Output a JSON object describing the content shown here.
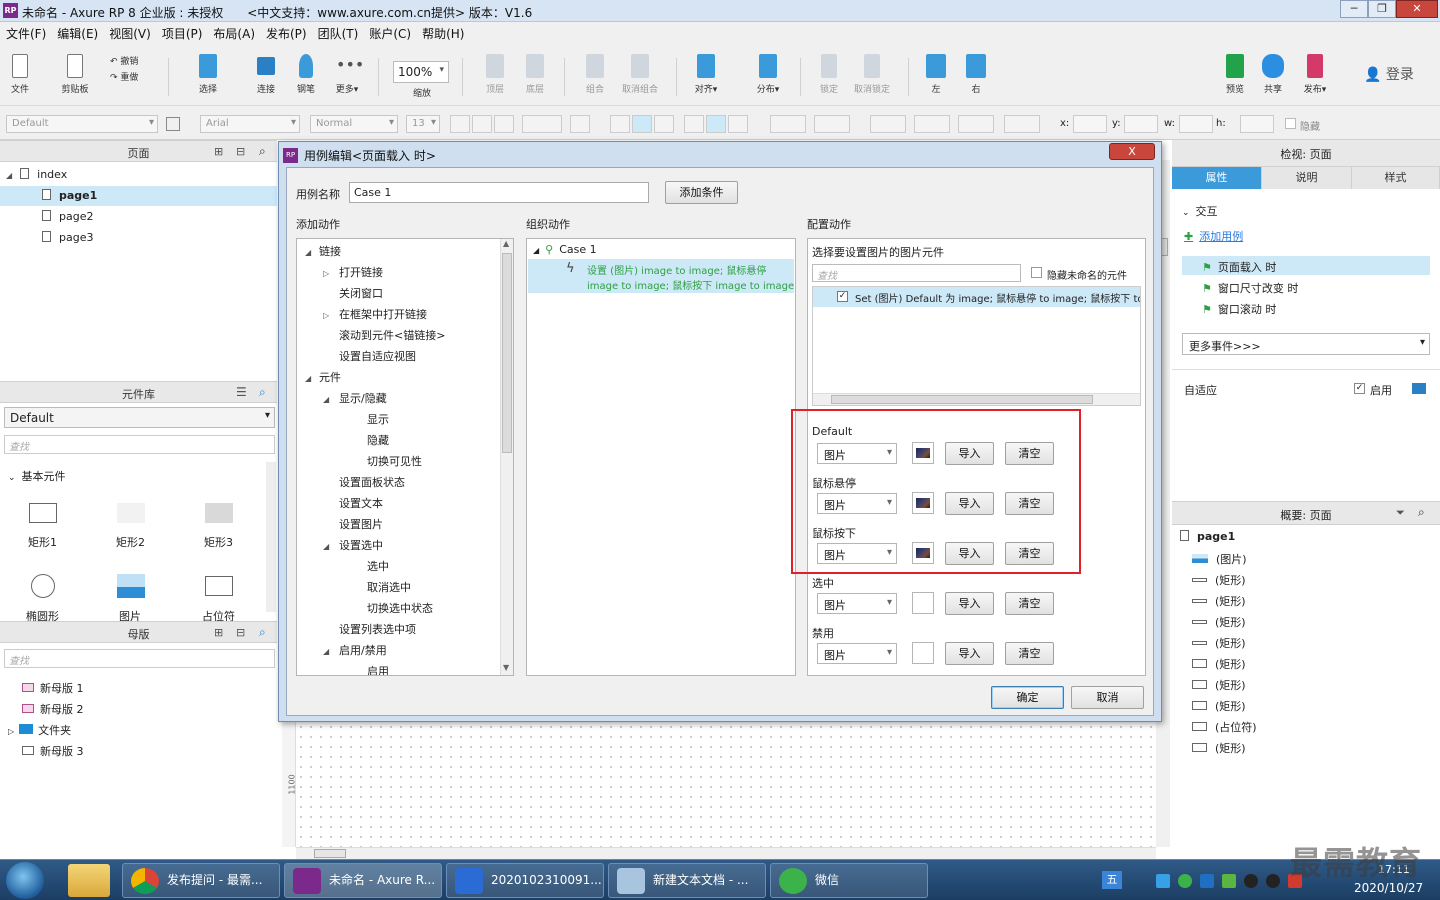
{
  "window": {
    "title": "未命名 - Axure RP 8 企业版 : 未授权　　<中文支持：www.axure.com.cn提供> 版本：V1.6",
    "logo": "RP"
  },
  "menu": [
    "文件(F)",
    "编辑(E)",
    "视图(V)",
    "项目(P)",
    "布局(A)",
    "发布(P)",
    "团队(T)",
    "账户(C)",
    "帮助(H)"
  ],
  "toolbar": {
    "file": "文件",
    "clipboard": "剪贴板",
    "undo": "撤销",
    "redo": "重做",
    "select": "选择",
    "connect": "连接",
    "pen": "钢笔",
    "more": "更多▾",
    "zoom": "100%",
    "zoom_label": "缩放",
    "top": "顶层",
    "bottom": "底层",
    "group": "组合",
    "ungroup": "取消组合",
    "align": "对齐▾",
    "distribute": "分布▾",
    "lock": "锁定",
    "unlock": "取消锁定",
    "left": "左",
    "right": "右",
    "preview": "预览",
    "share": "共享",
    "publish": "发布▾",
    "login": "登录"
  },
  "format": {
    "style": "Default",
    "font": "Arial",
    "weight": "Normal",
    "size": "13",
    "x": "x:",
    "y": "y:",
    "w": "w:",
    "h": "h:",
    "hidden": "隐藏"
  },
  "pages_panel": {
    "title": "页面",
    "items": [
      "index",
      "page1",
      "page2",
      "page3"
    ]
  },
  "library_panel": {
    "title": "元件库",
    "select": "Default",
    "search_placeholder": "查找",
    "group": "基本元件",
    "widgets": [
      "矩形1",
      "矩形2",
      "矩形3",
      "椭圆形",
      "图片",
      "占位符"
    ]
  },
  "masters_panel": {
    "title": "母版",
    "search_placeholder": "查找",
    "items": [
      "新母版 1",
      "新母版 2",
      "文件夹",
      "新母版 3"
    ]
  },
  "dialog": {
    "title": "用例编辑<页面载入 时>",
    "close": "X",
    "case_name_label": "用例名称",
    "case_name_value": "Case 1",
    "add_condition": "添加条件",
    "add_actions_title": "添加动作",
    "organize_title": "组织动作",
    "config_title": "配置动作",
    "actions_tree": [
      {
        "t": "链接",
        "lv": 0,
        "exp": "◢"
      },
      {
        "t": "打开链接",
        "lv": 1,
        "exp": "▷"
      },
      {
        "t": "关闭窗口",
        "lv": 1,
        "exp": ""
      },
      {
        "t": "在框架中打开链接",
        "lv": 1,
        "exp": "▷"
      },
      {
        "t": "滚动到元件<锚链接>",
        "lv": 1,
        "exp": ""
      },
      {
        "t": "设置自适应视图",
        "lv": 1,
        "exp": ""
      },
      {
        "t": "元件",
        "lv": 0,
        "exp": "◢"
      },
      {
        "t": "显示/隐藏",
        "lv": 1,
        "exp": "◢"
      },
      {
        "t": "显示",
        "lv": 2,
        "exp": ""
      },
      {
        "t": "隐藏",
        "lv": 2,
        "exp": ""
      },
      {
        "t": "切换可见性",
        "lv": 2,
        "exp": ""
      },
      {
        "t": "设置面板状态",
        "lv": 1,
        "exp": ""
      },
      {
        "t": "设置文本",
        "lv": 1,
        "exp": ""
      },
      {
        "t": "设置图片",
        "lv": 1,
        "exp": ""
      },
      {
        "t": "设置选中",
        "lv": 1,
        "exp": "◢"
      },
      {
        "t": "选中",
        "lv": 2,
        "exp": ""
      },
      {
        "t": "取消选中",
        "lv": 2,
        "exp": ""
      },
      {
        "t": "切换选中状态",
        "lv": 2,
        "exp": ""
      },
      {
        "t": "设置列表选中项",
        "lv": 1,
        "exp": ""
      },
      {
        "t": "启用/禁用",
        "lv": 1,
        "exp": "◢"
      },
      {
        "t": "启用",
        "lv": 2,
        "exp": ""
      }
    ],
    "case_node": "Case 1",
    "action_line1": "设置 (图片) image to image; 鼠标悬停",
    "action_line2": "image to image; 鼠标按下 image to image",
    "select_widget_label": "选择要设置图片的图片元件",
    "search_placeholder": "查找",
    "hide_unnamed": "隐藏未命名的元件",
    "widget_row": "Set (图片) Default 为 image; 鼠标悬停 to image; 鼠标按下 to",
    "states": [
      {
        "label": "Default",
        "select": "图片",
        "import": "导入",
        "clear": "清空",
        "has_image": true
      },
      {
        "label": "鼠标悬停",
        "select": "图片",
        "import": "导入",
        "clear": "清空",
        "has_image": true
      },
      {
        "label": "鼠标按下",
        "select": "图片",
        "import": "导入",
        "clear": "清空",
        "has_image": true
      },
      {
        "label": "选中",
        "select": "图片",
        "import": "导入",
        "clear": "清空",
        "has_image": false
      },
      {
        "label": "禁用",
        "select": "图片",
        "import": "导入",
        "clear": "清空",
        "has_image": false
      }
    ],
    "ok": "确定",
    "cancel": "取消",
    "highlight_color": "#e0212a"
  },
  "inspector": {
    "title": "检视: 页面",
    "tabs": [
      "属性",
      "说明",
      "样式"
    ],
    "interaction": "交互",
    "add_case": "添加用例",
    "events": [
      "页面载入 时",
      "窗口尺寸改变 时",
      "窗口滚动 时"
    ],
    "more_events": "更多事件>>>",
    "adaptive": "自适应",
    "enable": "启用"
  },
  "outline": {
    "title": "概要: 页面",
    "root": "page1",
    "items": [
      "(图片)",
      "(矩形)",
      "(矩形)",
      "(矩形)",
      "(矩形)",
      "(矩形)",
      "(矩形)",
      "(矩形)",
      "(占位符)",
      "(矩形)"
    ]
  },
  "canvas": {
    "ruler_mark": "1100"
  },
  "taskbar": {
    "items": [
      "发布提问 - 最需...",
      "未命名 - Axure R...",
      "2020102310091...",
      "新建文本文档 - ...",
      "微信"
    ],
    "time": "17:11",
    "date": "2020/10/27",
    "watermark": "最需教育"
  },
  "colors": {
    "accent": "#3b9ad9",
    "selection": "#cde8f7",
    "add_case": "#2a7ae2",
    "green": "#2ea043"
  }
}
